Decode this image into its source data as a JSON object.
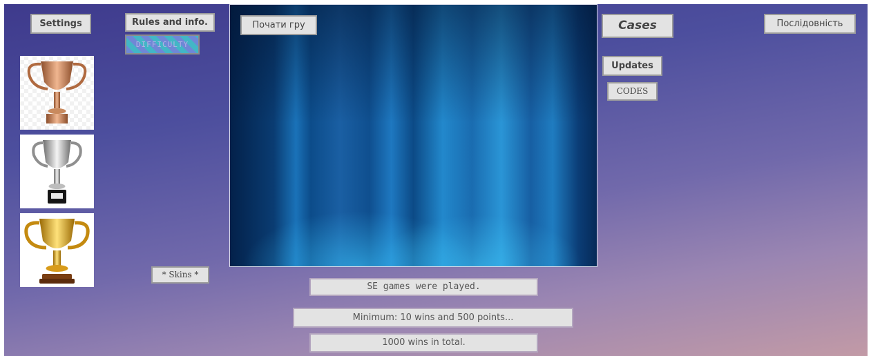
{
  "top_left": {
    "settings_label": "Settings",
    "rules_label": "Rules and info.",
    "difficulty_label": "DIFFICULTY"
  },
  "game": {
    "start_label": "Почати гру"
  },
  "right": {
    "cases_label": "Cases",
    "sequence_label": "Послідовність",
    "updates_label": "Updates",
    "codes_label": "CODES"
  },
  "left": {
    "skins_label": "* Skins *",
    "trophies": [
      {
        "name": "bronze-trophy-icon",
        "color": "#c98a5e"
      },
      {
        "name": "silver-trophy-icon",
        "color": "#c9c9c9"
      },
      {
        "name": "gold-trophy-icon",
        "color": "#e0a21c"
      }
    ]
  },
  "stats": {
    "played_text": "SE games were played.",
    "minimum_text": "Minimum: 10 wins and 500 points...",
    "total_text": "1000 wins in total."
  }
}
